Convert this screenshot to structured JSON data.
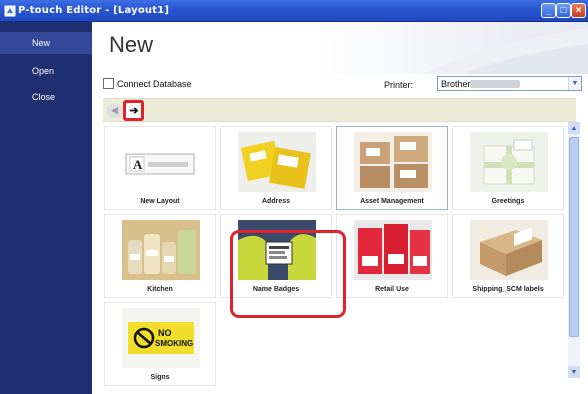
{
  "window": {
    "title": "P-touch Editor - [Layout1]",
    "minimize": "_",
    "maximize": "□",
    "close": "×"
  },
  "sidebar": {
    "items": [
      {
        "label": "New",
        "active": true
      },
      {
        "label": "Open",
        "active": false
      },
      {
        "label": "Close",
        "active": false
      }
    ]
  },
  "main": {
    "title": "New",
    "connect_database": {
      "label": "Connect Database",
      "checked": false
    },
    "printer": {
      "label": "Printer:",
      "value": "Brother"
    }
  },
  "nav": {
    "back_icon": "back-arrow-icon",
    "forward_icon": "forward-arrow-icon"
  },
  "templates": [
    {
      "label": "New Layout",
      "selected": false
    },
    {
      "label": "Address",
      "selected": false
    },
    {
      "label": "Asset Management",
      "selected": true
    },
    {
      "label": "Greetings",
      "selected": false
    },
    {
      "label": "Kitchen",
      "selected": false
    },
    {
      "label": "Name Badges",
      "selected": false
    },
    {
      "label": "Retail Use",
      "selected": false
    },
    {
      "label": "Shipping_SCM labels",
      "selected": false
    },
    {
      "label": "Signs",
      "selected": false
    }
  ],
  "new_layout_thumb": {
    "letter": "A"
  },
  "signs_thumb": {
    "line1": "NO",
    "line2": "SMOKING"
  },
  "colors": {
    "title_bar": "#2a58d4",
    "sidebar": "#1f2f70",
    "sidebar_active": "#34489b",
    "highlight": "#e0222a",
    "nav_strip": "#ecebd8"
  }
}
